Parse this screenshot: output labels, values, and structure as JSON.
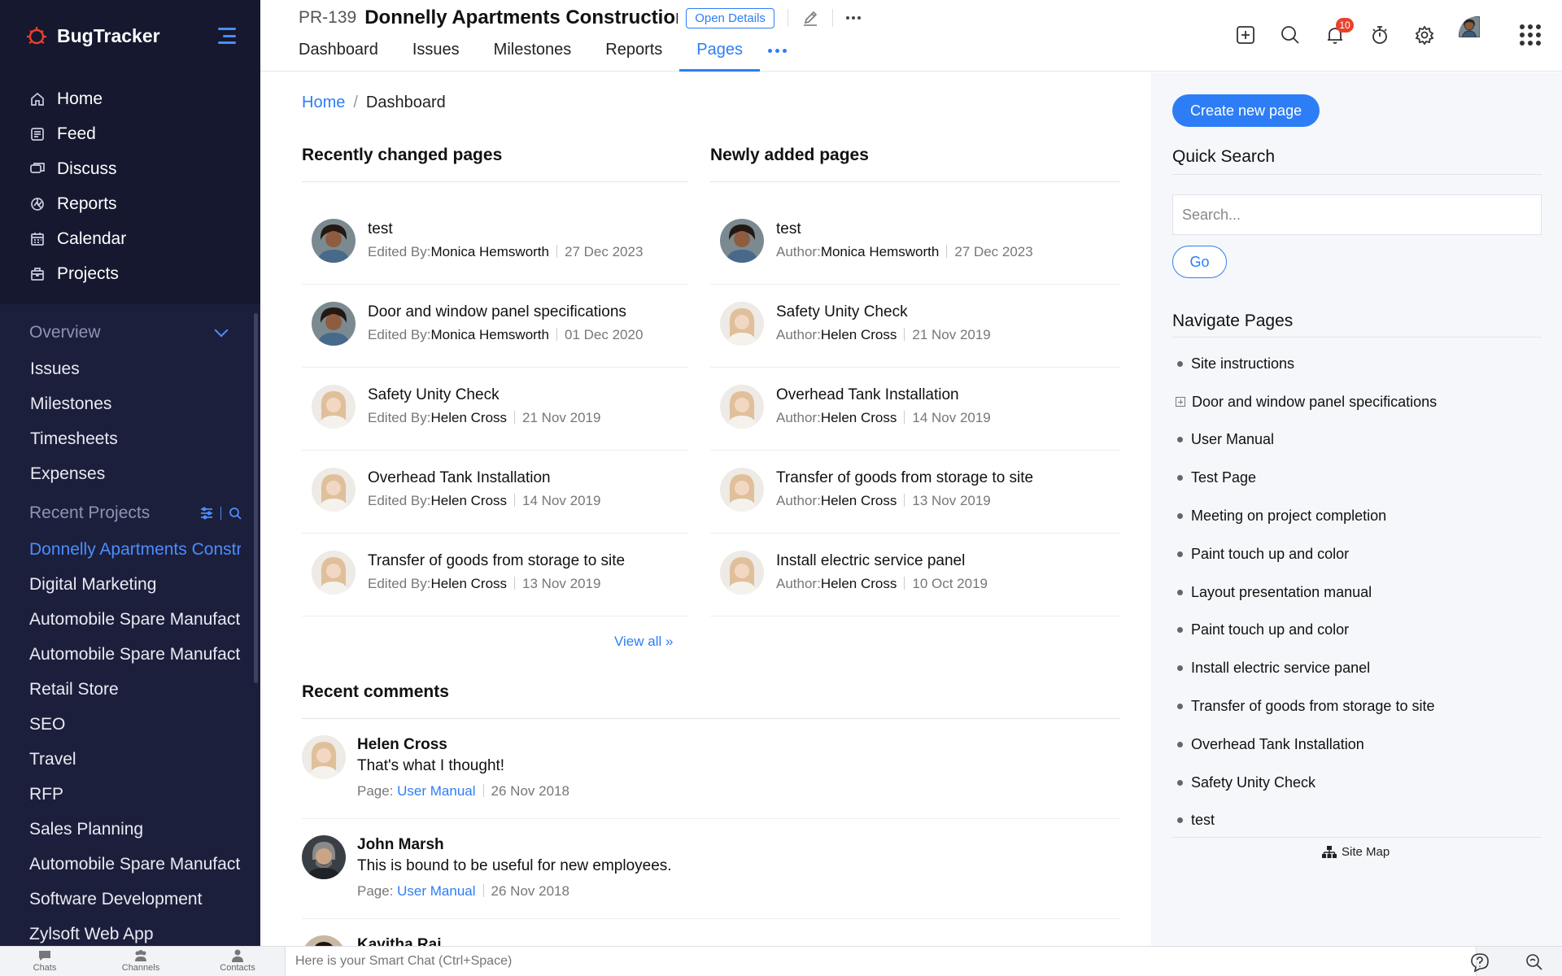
{
  "app": {
    "name": "BugTracker"
  },
  "sidebar": {
    "main_items": [
      {
        "label": "Home",
        "icon": "home-icon"
      },
      {
        "label": "Feed",
        "icon": "feed-icon"
      },
      {
        "label": "Discuss",
        "icon": "discuss-icon"
      },
      {
        "label": "Reports",
        "icon": "reports-icon"
      },
      {
        "label": "Calendar",
        "icon": "calendar-icon"
      },
      {
        "label": "Projects",
        "icon": "projects-icon"
      }
    ],
    "overview_label": "Overview",
    "overview_items": [
      "Issues",
      "Milestones",
      "Timesheets",
      "Expenses"
    ],
    "recent_projects_label": "Recent Projects",
    "recent_projects": [
      "Donnelly Apartments Construction",
      "Digital Marketing",
      "Automobile Spare Manufacturing",
      "Automobile Spare Manufacturing",
      "Retail Store",
      "SEO",
      "Travel",
      "RFP",
      "Sales Planning",
      "Automobile Spare Manufacturing",
      "Software Development",
      "Zylsoft Web App"
    ]
  },
  "header": {
    "project_id": "PR-139",
    "project_name": "Donnelly Apartments Construction",
    "open_details_label": "Open Details",
    "tabs": [
      "Dashboard",
      "Issues",
      "Milestones",
      "Reports",
      "Pages"
    ],
    "active_tab": "Pages",
    "notification_count": "10"
  },
  "breadcrumb": {
    "home": "Home",
    "current": "Dashboard"
  },
  "recently_changed": {
    "title": "Recently changed pages",
    "meta_prefix": "Edited By:",
    "items": [
      {
        "title": "test",
        "user": "Monica Hemsworth",
        "date": "27 Dec 2023",
        "avatar": "monica"
      },
      {
        "title": "Door and window panel specifications",
        "user": "Monica Hemsworth",
        "date": "01 Dec 2020",
        "avatar": "monica"
      },
      {
        "title": "Safety Unity Check",
        "user": "Helen Cross",
        "date": "21 Nov 2019",
        "avatar": "helen"
      },
      {
        "title": "Overhead Tank Installation",
        "user": "Helen Cross",
        "date": "14 Nov 2019",
        "avatar": "helen"
      },
      {
        "title": "Transfer of goods from storage to site",
        "user": "Helen Cross",
        "date": "13 Nov 2019",
        "avatar": "helen"
      }
    ],
    "view_all": "View all »"
  },
  "newly_added": {
    "title": "Newly added pages",
    "meta_prefix": "Author:",
    "items": [
      {
        "title": "test",
        "user": "Monica Hemsworth",
        "date": "27 Dec 2023",
        "avatar": "monica"
      },
      {
        "title": "Safety Unity Check",
        "user": "Helen Cross",
        "date": "21 Nov 2019",
        "avatar": "helen"
      },
      {
        "title": "Overhead Tank Installation",
        "user": "Helen Cross",
        "date": "14 Nov 2019",
        "avatar": "helen"
      },
      {
        "title": "Transfer of goods from storage to site",
        "user": "Helen Cross",
        "date": "13 Nov 2019",
        "avatar": "helen"
      },
      {
        "title": "Install electric service panel",
        "user": "Helen Cross",
        "date": "10 Oct 2019",
        "avatar": "helen"
      }
    ]
  },
  "recent_comments": {
    "title": "Recent comments",
    "page_prefix": "Page: ",
    "items": [
      {
        "name": "Helen Cross",
        "text": "That's what I thought!",
        "page": "User Manual",
        "date": "26 Nov 2018",
        "avatar": "helen"
      },
      {
        "name": "John Marsh",
        "text": "This is bound to be useful for new employees.",
        "page": "User Manual",
        "date": "26 Nov 2018",
        "avatar": "john"
      },
      {
        "name": "Kavitha Raj",
        "text": "",
        "page": "",
        "date": "",
        "avatar": "kavitha"
      }
    ]
  },
  "right_panel": {
    "create_button": "Create new page",
    "quick_search_title": "Quick Search",
    "search_placeholder": "Search...",
    "go_button": "Go",
    "navigate_title": "Navigate Pages",
    "nav_pages": [
      {
        "label": "Site instructions",
        "marker": "dot"
      },
      {
        "label": "Door and window panel specifications",
        "marker": "plus"
      },
      {
        "label": "User Manual",
        "marker": "dot"
      },
      {
        "label": "Test Page",
        "marker": "dot"
      },
      {
        "label": "Meeting on project completion",
        "marker": "dot"
      },
      {
        "label": "Paint touch up and color",
        "marker": "dot"
      },
      {
        "label": "Layout presentation manual",
        "marker": "dot"
      },
      {
        "label": "Paint touch up and color",
        "marker": "dot"
      },
      {
        "label": "Install electric service panel",
        "marker": "dot"
      },
      {
        "label": "Transfer of goods from storage to site",
        "marker": "dot"
      },
      {
        "label": "Overhead Tank Installation",
        "marker": "dot"
      },
      {
        "label": "Safety Unity Check",
        "marker": "dot"
      },
      {
        "label": "test",
        "marker": "dot"
      }
    ],
    "site_map": "Site Map"
  },
  "bottom_bar": {
    "tabs": [
      "Chats",
      "Channels",
      "Contacts"
    ],
    "smart_chat_placeholder": "Here is your Smart Chat (Ctrl+Space)"
  },
  "colors": {
    "accent": "#2d7df6",
    "sidebar_bg": "#1c1f3b",
    "sidebar_top_bg": "#15182f",
    "badge": "#e8412c"
  }
}
